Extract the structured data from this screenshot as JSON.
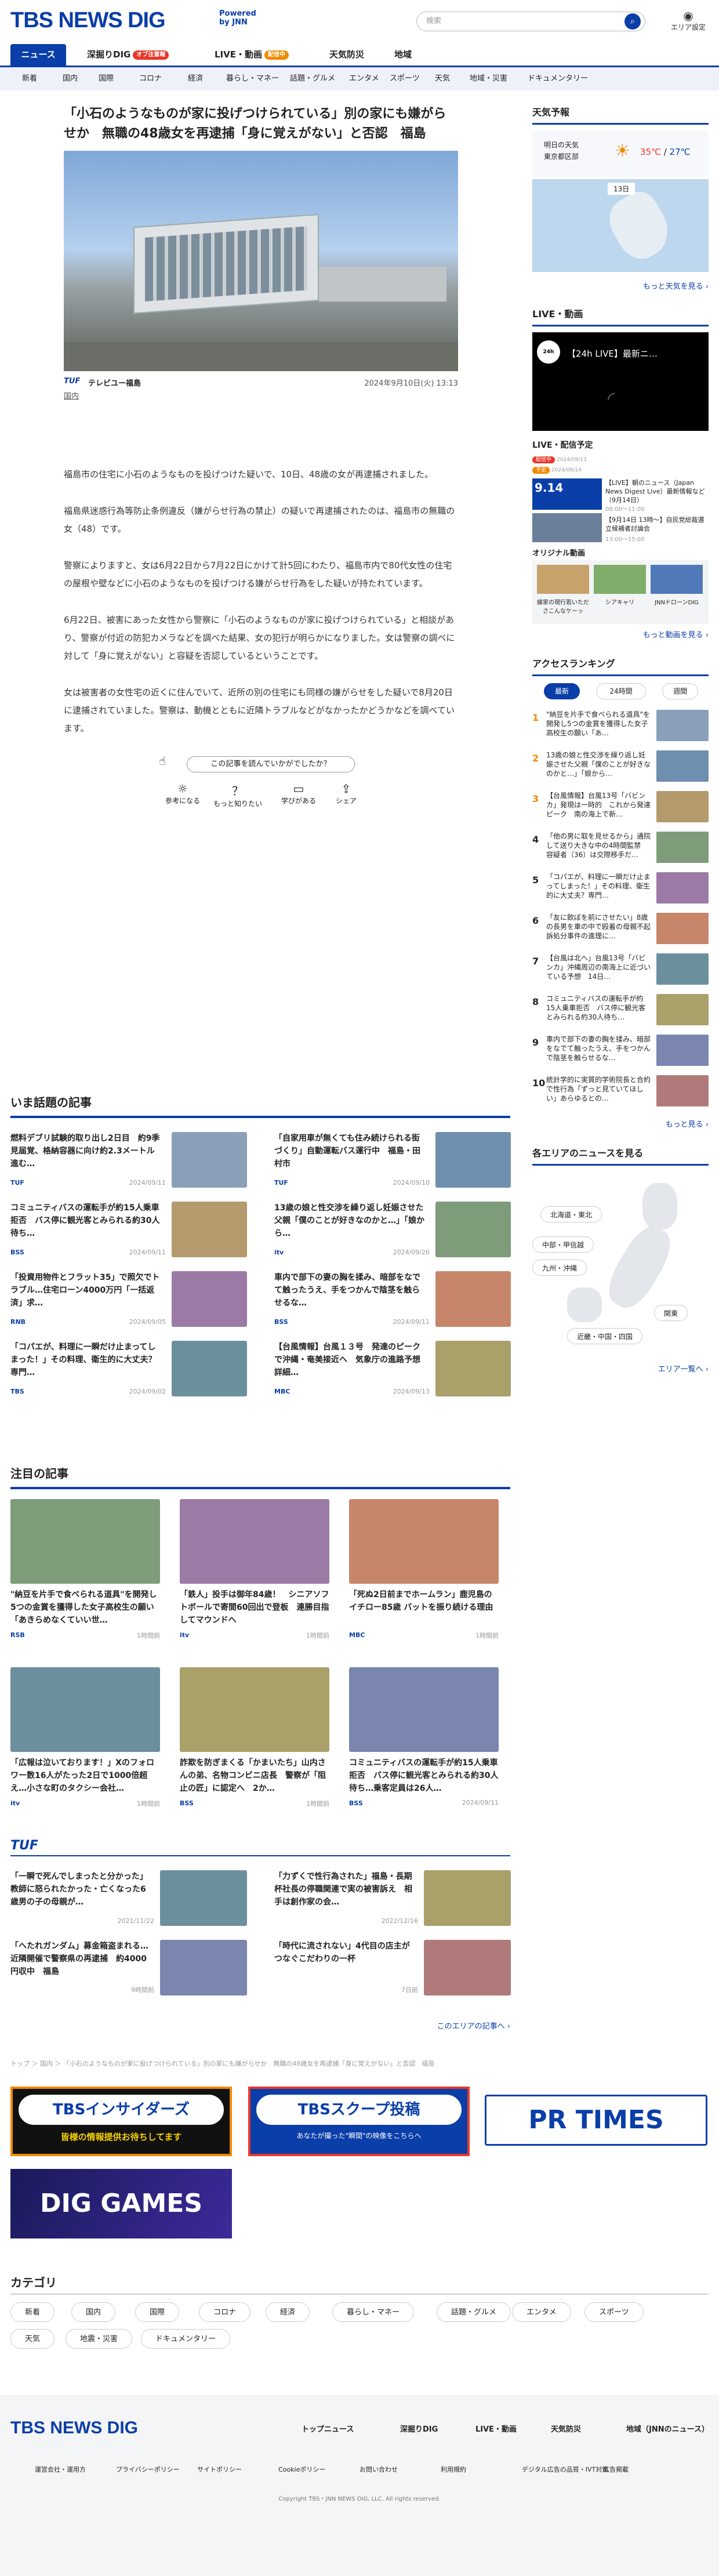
{
  "header": {
    "logo": "TBS NEWS DIG",
    "powered_line1": "Powered",
    "powered_line2": "by JNN",
    "search_placeholder": "検索",
    "area_label": "エリア設定"
  },
  "tabs": [
    {
      "label": "ニュース"
    },
    {
      "label": "深掘りDIG",
      "badge": "オブ注意報"
    },
    {
      "label": "LIVE・動画",
      "badge": "配信中"
    },
    {
      "label": "天気防災"
    },
    {
      "label": "地域"
    }
  ],
  "categories": [
    "新着",
    "国内",
    "国際",
    "コロナ",
    "経済",
    "暮らし・マネー",
    "話題・グルメ",
    "エンタメ",
    "スポーツ",
    "天気",
    "地域・災害",
    "ドキュメンタリー"
  ],
  "article": {
    "title": "「小石のようなものが家に投げつけられている」別の家にも嫌がらせか　無職の48歳女を再逮捕「身に覚えがない」と否認　福島",
    "source": "テレビユー福島",
    "datetime": "2024年9月10日(火) 13:13",
    "category": "国内",
    "paragraphs": [
      "福島市の住宅に小石のようなものを投げつけた疑いで、10日、48歳の女が再逮捕されました。",
      "福島県迷惑行為等防止条例違反（嫌がらせ行為の禁止）の疑いで再逮捕されたのは、福島市の無職の女（48）です。",
      "警察によりますと、女は6月22日から7月22日にかけて計5回にわたり、福島市内で80代女性の住宅の屋根や壁などに小石のようなものを投げつける嫌がらせ行為をした疑いが持たれています。",
      "6月22日、被害にあった女性から警察に「小石のようなものが家に投げつけられている」と相談があり、警察が付近の防犯カメラなどを調べた結果、女の犯行が明らかになりました。女は警察の調べに対して「身に覚えがない」と容疑を否認しているということです。",
      "女は被害者の女性宅の近くに住んでいて、近所の別の住宅にも同様の嫌がらせをした疑いで8月20日に逮捕されていました。警察は、動機とともに近隣トラブルなどがなかったかどうかなどを調べています。"
    ],
    "feedback_question": "この記事を読んでいかがでしたか？",
    "reactions": [
      "参考になる",
      "もっと知りたい",
      "学びがある",
      "シェア"
    ]
  },
  "trending": {
    "heading": "いま話題の記事",
    "items": [
      {
        "text": "燃料デブリ試験的取り出し2日目　約9季見届覚、格納容器に向け約2.3メートル進む…",
        "src": "TUF",
        "date": "2024/09/11"
      },
      {
        "text": "「自家用車が無くても住み続けられる街づくり」自動運転バス運行中　福島・田村市",
        "src": "TUF",
        "date": "2024/09/10"
      },
      {
        "text": "コミュニティバスの運転手が約15人乗車拒否　バス停に観光客とみられる約30人待ち…",
        "src": "BSS",
        "date": "2024/09/11"
      },
      {
        "text": "13歳の娘と性交渉を繰り返し妊娠させた父親「僕のことが好きなのかと…」「娘から…",
        "src": "itv",
        "date": "2024/09/26"
      },
      {
        "text": "「投資用物件とフラット35」で照欠でトラブル…住宅ローン4000万円「一括返済」求…",
        "src": "RNB",
        "date": "2024/09/05"
      },
      {
        "text": "車内で部下の妻の胸を揉み、暗部をなでて触ったうえ、手をつかんで陰茎を触らせるな…",
        "src": "BSS",
        "date": "2024/09/11"
      },
      {
        "text": "「コパエが、料理に一瞬だけ止まってしまった！」その料理、衛生的に大丈夫？専門…",
        "src": "TBS",
        "date": "2024/09/02"
      },
      {
        "text": "【台風情報】台風１３号　発達のピークで沖縄・奄美接近へ　気象庁の進路予想詳細…",
        "src": "MBC",
        "date": "2024/09/13"
      }
    ]
  },
  "featured": {
    "heading": "注目の記事",
    "items": [
      {
        "text": "\"納豆を片手で食べられる道具\"を開発し5つの金賞を獲得した女子高校生の願い「あきらめなくていい世…",
        "src": "RSB",
        "date": "1時間前"
      },
      {
        "text": "「鉄人」投手は御年84歳！　シニアソフトボールで寄間60回出で登板　連勝目指してマウンドへ",
        "src": "itv",
        "date": "1時間前"
      },
      {
        "text": "「死ぬ2日前までホームラン」鹿児島のイチロー85歳 バットを振り続ける理由",
        "src": "MBC",
        "date": "1時間前"
      },
      {
        "text": "「広報は泣いております！」Xのフォロワー数16人がたった2日で1000倍超え…小さな町のタクシー会社…",
        "src": "itv",
        "date": "1時間前"
      },
      {
        "text": "詐欺を防ぎまくる「かまいたち」山内さんの弟、名物コンビニ店長　警察が「阻止の匠」に認定へ　2か…",
        "src": "BSS",
        "date": "1時間前"
      },
      {
        "text": "コミュニティバスの運転手が約15人乗車拒否　バス停に観光客とみられる約30人待ち…乗客定員は26人…",
        "src": "BSS",
        "date": "2024/09/11"
      }
    ]
  },
  "tuf": {
    "logo": "TUF",
    "items": [
      {
        "text": "「一瞬で死んでしまったと分かった」教師に怒られたかった・亡くなった6歳男の子の母親が…",
        "date": "2021/11/22"
      },
      {
        "text": "「力ずくで性行為された」福島・長期杯社長の停職関連で実の被害訴え　相手は創作家の会…",
        "date": "2022/12/16"
      },
      {
        "text": "「ヘたれガンダム」募金箱盗まれる…近隣開催で警察県の再逮捕　約4000円収中　福島",
        "date": "9時間前"
      },
      {
        "text": "「時代に流されない」4代目の店主がつなぐこだわりの一杯",
        "date": "7日前"
      }
    ],
    "more": "このエリアの記事へ ›"
  },
  "breadcrumb": "トップ ＞ 国内 ＞ 「小石のようなものが家に投げつけられている」別の家にも嫌がらせか　無職の48歳女を再逮捕「身に覚えがない」と否認　福島",
  "banners": [
    {
      "title": "TBSインサイダーズ",
      "sub": "皆様の情報提供お待ちしてます"
    },
    {
      "title": "TBSスクープ投稿",
      "sub": "あなたが撮った\"瞬間\"の映像をこちらへ"
    },
    {
      "title": "PR TIMES"
    },
    {
      "title": "DIG GAMES"
    }
  ],
  "category_section": {
    "heading": "カテゴリ",
    "items": [
      "新着",
      "国内",
      "国際",
      "コロナ",
      "経済",
      "暮らし・マネー",
      "話題・グルメ",
      "エンタメ",
      "スポーツ",
      "天気",
      "地震・災害",
      "ドキュメンタリー"
    ]
  },
  "footer": {
    "logo": "TBS NEWS DIG",
    "nav": [
      "トップニュース",
      "深掘りDIG",
      "LIVE・動画",
      "天気防災",
      "地域（JNNのニュース）"
    ],
    "links": [
      "運営会社・運用方",
      "プライバシーポリシー",
      "サイトポリシー",
      "Cookieポリシー",
      "お問い合わせ",
      "利用規約",
      "デジタル広告の品質・IVT対策",
      "広告掲載"
    ],
    "copyright": "Copyright TBS・JNN NEWS DIG, LLC. All rights reserved."
  },
  "sidebar": {
    "weather": {
      "heading": "天気予報",
      "today_label": "明日の天気",
      "region": "東京都区部",
      "temp_high": "35℃",
      "temp_low": "27℃",
      "day": "13日",
      "more": "もっと天気を見る ›"
    },
    "live": {
      "heading": "LIVE・動画",
      "video_title": "【24h LIVE】最新ニ…",
      "schedule_heading": "LIVE・配信予定",
      "items": [
        {
          "status": "配信中",
          "date": "2024/09/13",
          "text": ""
        },
        {
          "status": "予定",
          "date": "2024/09/14",
          "text": "【LIVE】朝のニュース（Japan News Digest Live）最新情報など（9月14日）",
          "time": "08:00〜11:00"
        },
        {
          "status": "",
          "date": "",
          "text": "【9月14日 13時〜】自民党総裁選 立候補者討論会",
          "time": "13:00〜15:00"
        }
      ],
      "original_heading": "オリジナル動画",
      "originals": [
        "縁家の現行若いたださこんなケーッ",
        "シアキャリ",
        "JNNドローンDIG"
      ],
      "more": "もっと動画を見る ›"
    },
    "ranking": {
      "heading": "アクセスランキング",
      "tabs": [
        "最新",
        "24時間",
        "週間"
      ],
      "items": [
        "\"納豆を片手で食べられる道具\"を開発し5つの金賞を獲得した女子高校生の願い「あ…",
        "13歳の娘と性交渉を繰り返し妊娠させた父親「僕のことが好きなのかと…」「娘から…",
        "【台風情報】台風13号「バビンカ」発現は一時的　これから発達ピーク　南の海上で新…",
        "「他の男に取を見せるから」通院して送り大きな中の4時間監禁　容疑者（36）は交際移手だ…",
        "「コパエが、料理に一瞬だけ止まってしまった！」その料理、衛生的に大丈夫？専門…",
        "「友に飲ぼを前にさせたい」8歳の長男を車の中で殴着の母親不起訴処分事件の進理に…",
        "【台風は北へ」台風13号「バビンカ」沖縄周辺の南海上に近づいている予想　14日…",
        "コミュニティバスの運転手が約15人乗車拒否　バス停に観光客とみられる約30人待ち…",
        "車内で部下の妻の胸を揉み、暗部をなでて触ったうえ、手をつかんで陰茎を触らせるな…",
        "統計学的に実質的学術院長と合約で性行為「ずっと見ていてほしい」あらゆるとの…"
      ],
      "more": "もっと見る ›"
    },
    "areas": {
      "heading": "各エリアのニュースを見る",
      "regions": [
        "北海道・東北",
        "中部・甲信越",
        "九州・沖縄",
        "関東",
        "近畿・中国・四国"
      ],
      "more": "エリア一覧へ ›"
    }
  },
  "colors": {
    "brand": "#0a3ea8",
    "accent_orange": "#f08a00",
    "live_red": "#e8372c"
  }
}
